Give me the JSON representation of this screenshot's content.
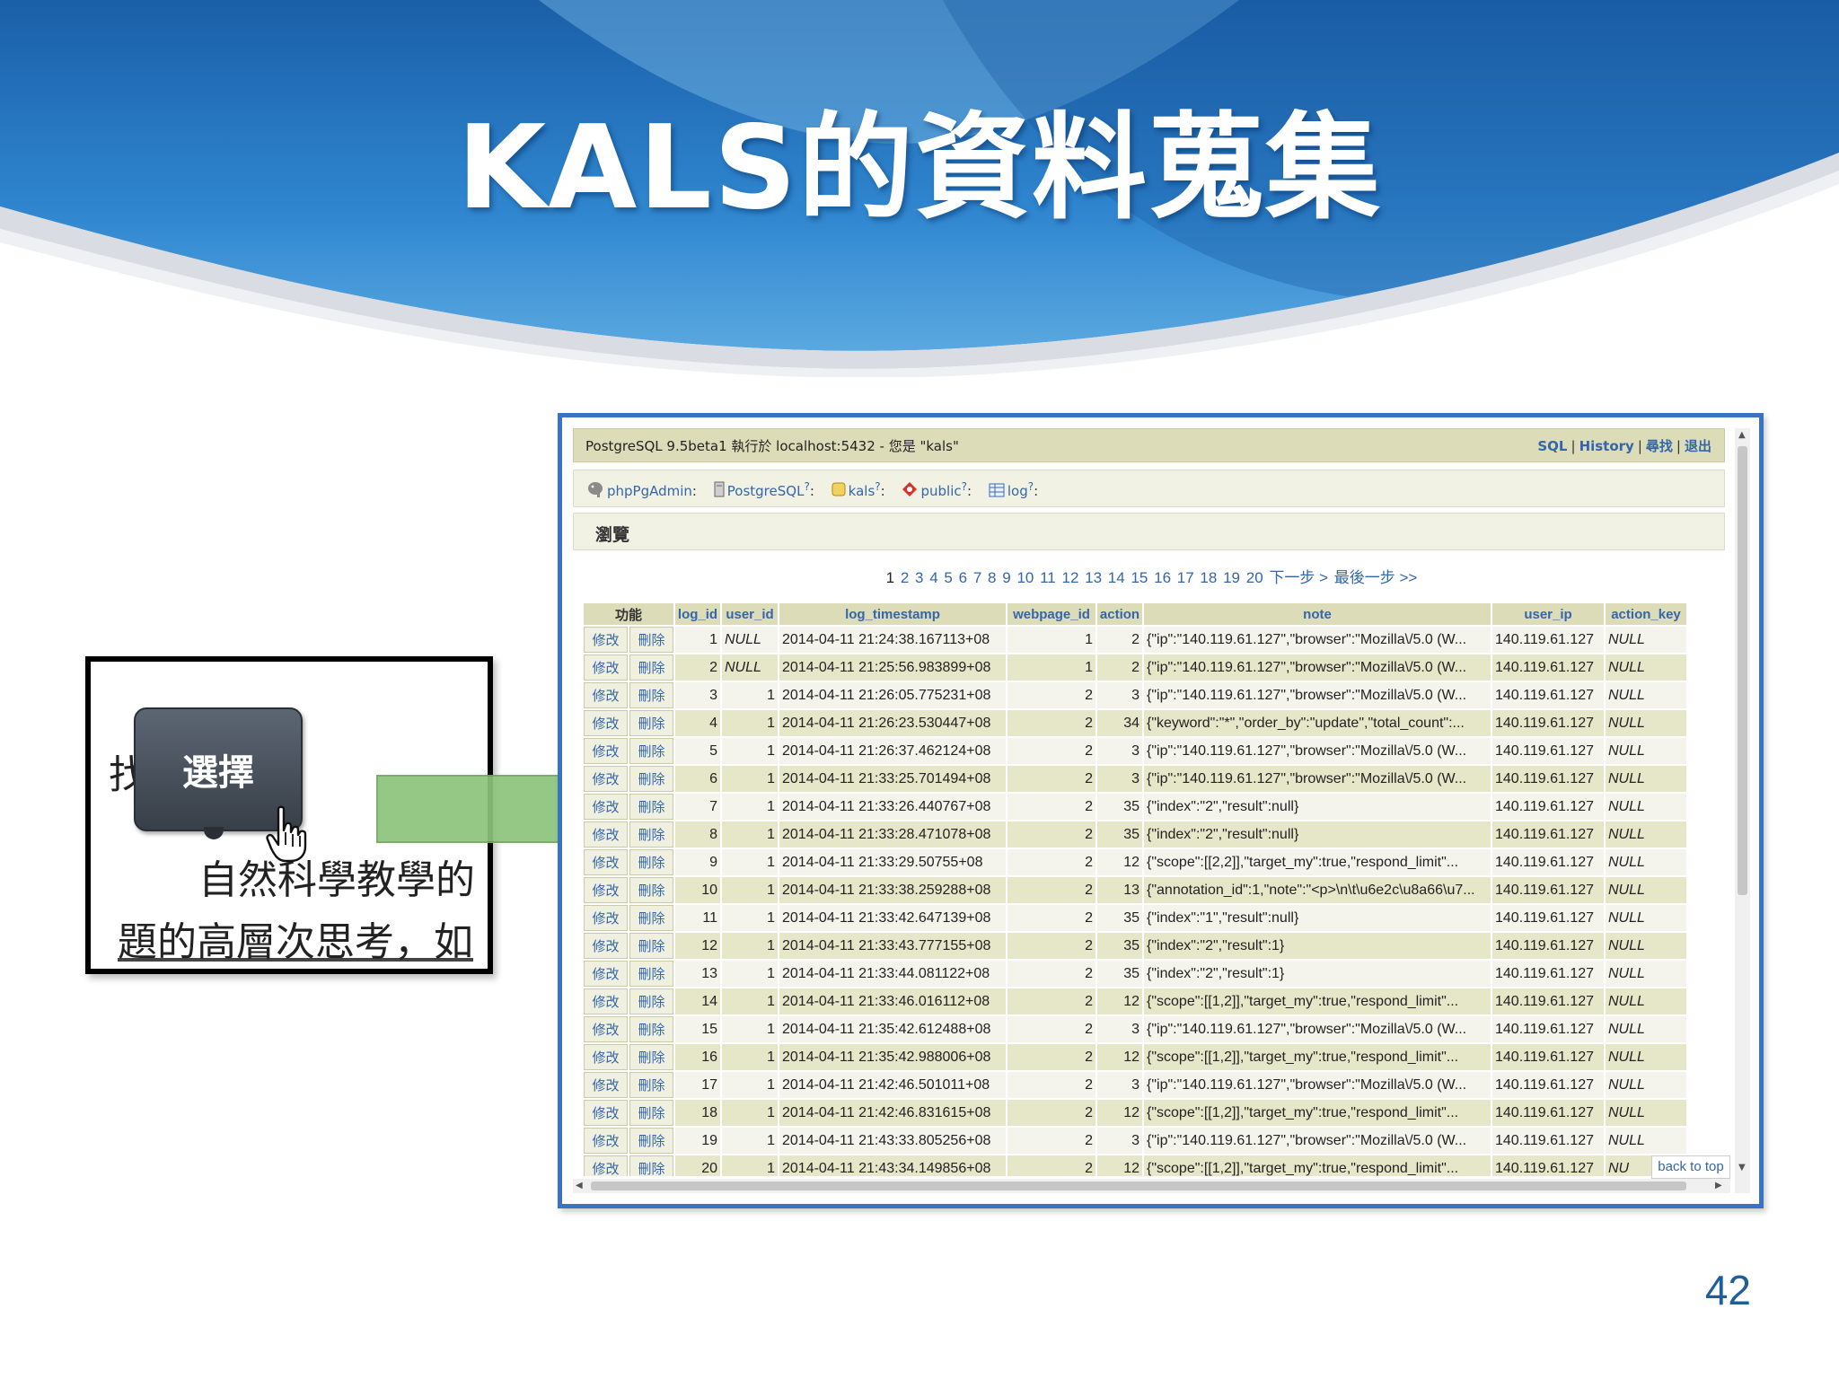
{
  "slide": {
    "title": "KALS的資料蒐集",
    "page_number": "42"
  },
  "crop": {
    "hidden_char": "找",
    "button_label": "選擇",
    "line1": "自然科學教學的",
    "line2": "題的高層次思考，如"
  },
  "phppgadmin": {
    "topbar": {
      "server_info": "PostgreSQL 9.5beta1 執行於 localhost:5432 - 您是 \"kals\"",
      "links": [
        "SQL",
        "History",
        "尋找",
        "退出"
      ]
    },
    "breadcrumb": [
      "phpPgAdmin",
      "PostgreSQL",
      "kals",
      "public",
      "log"
    ],
    "section_title": "瀏覽",
    "pager": {
      "pages": [
        "1",
        "2",
        "3",
        "4",
        "5",
        "6",
        "7",
        "8",
        "9",
        "10",
        "11",
        "12",
        "13",
        "14",
        "15",
        "16",
        "17",
        "18",
        "19",
        "20"
      ],
      "current": "1",
      "next": "下一步 >",
      "last": "最後一步 >>"
    },
    "table": {
      "columns": [
        "功能",
        "log_id",
        "user_id",
        "log_timestamp",
        "webpage_id",
        "action",
        "note",
        "user_ip",
        "action_key"
      ],
      "edit_label": "修改",
      "delete_label": "刪除",
      "rows": [
        [
          "1",
          "NULL",
          "2014-04-11 21:24:38.167113+08",
          "1",
          "2",
          "{\"ip\":\"140.119.61.127\",\"browser\":\"Mozilla\\/5.0 (W...",
          "140.119.61.127",
          "NULL"
        ],
        [
          "2",
          "NULL",
          "2014-04-11 21:25:56.983899+08",
          "1",
          "2",
          "{\"ip\":\"140.119.61.127\",\"browser\":\"Mozilla\\/5.0 (W...",
          "140.119.61.127",
          "NULL"
        ],
        [
          "3",
          "1",
          "2014-04-11 21:26:05.775231+08",
          "2",
          "3",
          "{\"ip\":\"140.119.61.127\",\"browser\":\"Mozilla\\/5.0 (W...",
          "140.119.61.127",
          "NULL"
        ],
        [
          "4",
          "1",
          "2014-04-11 21:26:23.530447+08",
          "2",
          "34",
          "{\"keyword\":\"*\",\"order_by\":\"update\",\"total_count\":...",
          "140.119.61.127",
          "NULL"
        ],
        [
          "5",
          "1",
          "2014-04-11 21:26:37.462124+08",
          "2",
          "3",
          "{\"ip\":\"140.119.61.127\",\"browser\":\"Mozilla\\/5.0 (W...",
          "140.119.61.127",
          "NULL"
        ],
        [
          "6",
          "1",
          "2014-04-11 21:33:25.701494+08",
          "2",
          "3",
          "{\"ip\":\"140.119.61.127\",\"browser\":\"Mozilla\\/5.0 (W...",
          "140.119.61.127",
          "NULL"
        ],
        [
          "7",
          "1",
          "2014-04-11 21:33:26.440767+08",
          "2",
          "35",
          "{\"index\":\"2\",\"result\":null}",
          "140.119.61.127",
          "NULL"
        ],
        [
          "8",
          "1",
          "2014-04-11 21:33:28.471078+08",
          "2",
          "35",
          "{\"index\":\"2\",\"result\":null}",
          "140.119.61.127",
          "NULL"
        ],
        [
          "9",
          "1",
          "2014-04-11 21:33:29.50755+08",
          "2",
          "12",
          "{\"scope\":[[2,2]],\"target_my\":true,\"respond_limit\"...",
          "140.119.61.127",
          "NULL"
        ],
        [
          "10",
          "1",
          "2014-04-11 21:33:38.259288+08",
          "2",
          "13",
          "{\"annotation_id\":1,\"note\":\"<p>\\n\\t\\u6e2c\\u8a66\\u7...",
          "140.119.61.127",
          "NULL"
        ],
        [
          "11",
          "1",
          "2014-04-11 21:33:42.647139+08",
          "2",
          "35",
          "{\"index\":\"1\",\"result\":null}",
          "140.119.61.127",
          "NULL"
        ],
        [
          "12",
          "1",
          "2014-04-11 21:33:43.777155+08",
          "2",
          "35",
          "{\"index\":\"2\",\"result\":1}",
          "140.119.61.127",
          "NULL"
        ],
        [
          "13",
          "1",
          "2014-04-11 21:33:44.081122+08",
          "2",
          "35",
          "{\"index\":\"2\",\"result\":1}",
          "140.119.61.127",
          "NULL"
        ],
        [
          "14",
          "1",
          "2014-04-11 21:33:46.016112+08",
          "2",
          "12",
          "{\"scope\":[[1,2]],\"target_my\":true,\"respond_limit\"...",
          "140.119.61.127",
          "NULL"
        ],
        [
          "15",
          "1",
          "2014-04-11 21:35:42.612488+08",
          "2",
          "3",
          "{\"ip\":\"140.119.61.127\",\"browser\":\"Mozilla\\/5.0 (W...",
          "140.119.61.127",
          "NULL"
        ],
        [
          "16",
          "1",
          "2014-04-11 21:35:42.988006+08",
          "2",
          "12",
          "{\"scope\":[[1,2]],\"target_my\":true,\"respond_limit\"...",
          "140.119.61.127",
          "NULL"
        ],
        [
          "17",
          "1",
          "2014-04-11 21:42:46.501011+08",
          "2",
          "3",
          "{\"ip\":\"140.119.61.127\",\"browser\":\"Mozilla\\/5.0 (W...",
          "140.119.61.127",
          "NULL"
        ],
        [
          "18",
          "1",
          "2014-04-11 21:42:46.831615+08",
          "2",
          "12",
          "{\"scope\":[[1,2]],\"target_my\":true,\"respond_limit\"...",
          "140.119.61.127",
          "NULL"
        ],
        [
          "19",
          "1",
          "2014-04-11 21:43:33.805256+08",
          "2",
          "3",
          "{\"ip\":\"140.119.61.127\",\"browser\":\"Mozilla\\/5.0 (W...",
          "140.119.61.127",
          "NULL"
        ],
        [
          "20",
          "1",
          "2014-04-11 21:43:34.149856+08",
          "2",
          "12",
          "{\"scope\":[[1,2]],\"target_my\":true,\"respond_limit\"...",
          "140.119.61.127",
          "NU"
        ]
      ]
    },
    "back_to_top": "back to top"
  },
  "colors": {
    "banner_blue": "#1f6fb8",
    "arrow_green": "#8cc47a",
    "frame_blue": "#3a73c4",
    "header_olive": "#dcddb8",
    "link_blue": "#3366aa"
  },
  "icons": [
    "elephant-icon",
    "server-icon",
    "database-icon",
    "schema-icon",
    "table-icon",
    "hand-cursor-icon",
    "right-arrow-icon"
  ]
}
